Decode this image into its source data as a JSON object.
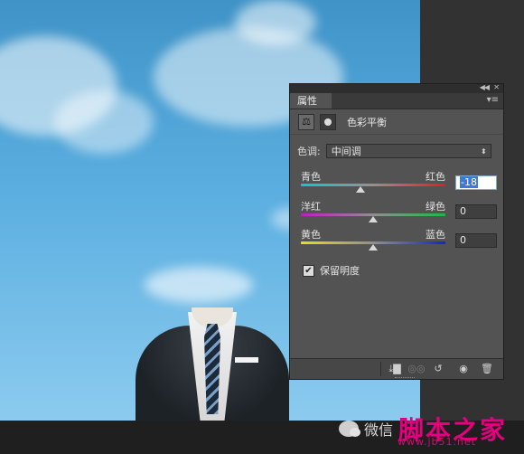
{
  "panel": {
    "tab_label": "属性",
    "collapse_icon": "double-chevron-left-icon",
    "close_icon": "close-icon",
    "menu_icon": "panel-menu-icon",
    "adjustment_title": "色彩平衡",
    "tone_label": "色调:",
    "tone_value": "中间调",
    "sliders": [
      {
        "left": "青色",
        "right": "红色",
        "value": "-18",
        "position": 0.41,
        "track": "linear-gradient(90deg,#10c6d6,#9a8e8e 50%,#e0201d)"
      },
      {
        "left": "洋红",
        "right": "绿色",
        "value": "0",
        "position": 0.5,
        "track": "linear-gradient(90deg,#c21cc6,#8f8f8f 50%,#22b54a)"
      },
      {
        "left": "黄色",
        "right": "蓝色",
        "value": "0",
        "position": 0.5,
        "track": "linear-gradient(90deg,#e6e20f,#8f8f8f 50%,#1b22c9)"
      }
    ],
    "preserve_luminosity_label": "保留明度",
    "preserve_luminosity_checked": true
  },
  "watermark": {
    "wechat_text": "微信",
    "brand": "脚本之家",
    "url": "www.jb51.net"
  },
  "colors": {
    "panel_bg": "#535353",
    "brand": "#e4007f"
  }
}
